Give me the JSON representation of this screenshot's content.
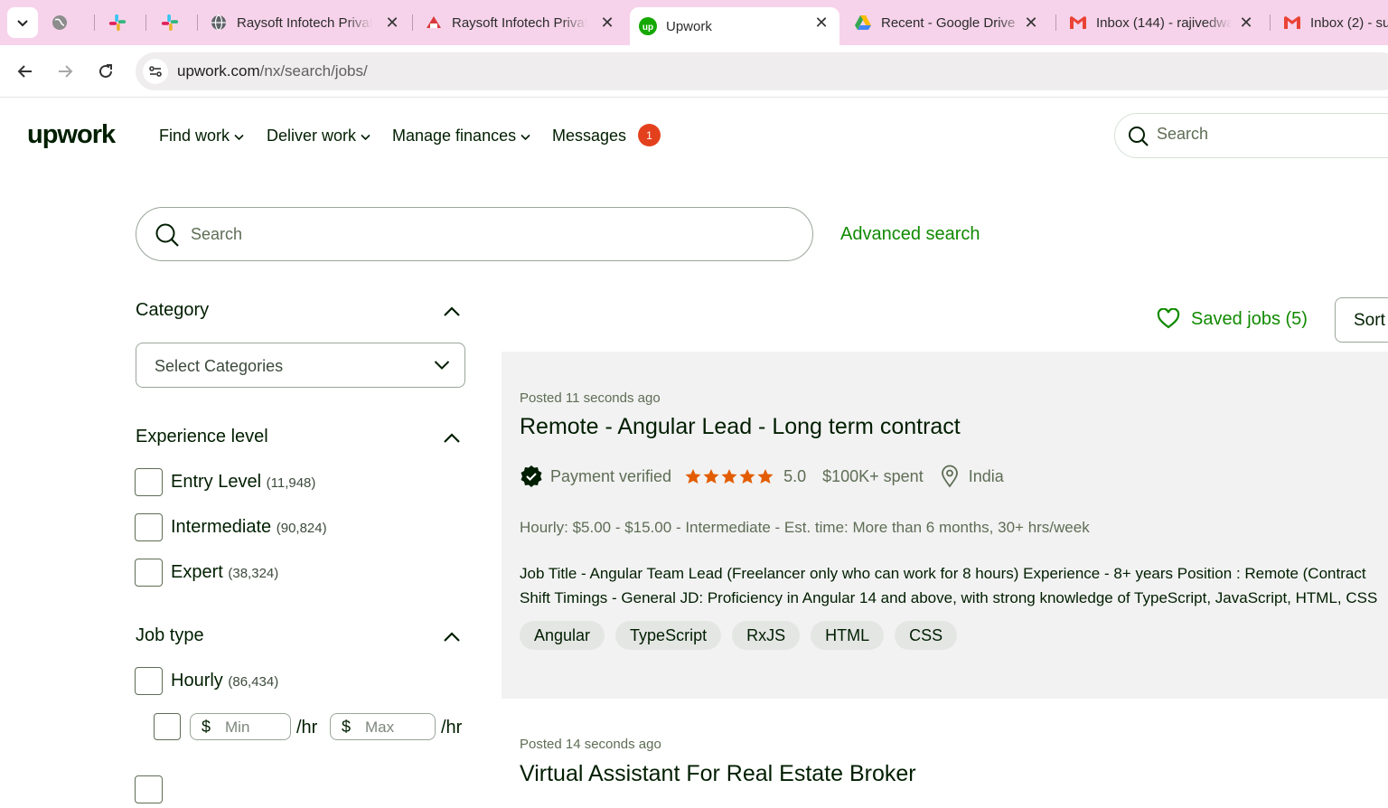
{
  "browser": {
    "tabs": [
      {
        "title": "",
        "icon": "globe-icon"
      },
      {
        "title": "",
        "icon": "slack-icon"
      },
      {
        "title": "",
        "icon": "slack-icon"
      },
      {
        "title": "Raysoft Infotech Privat",
        "icon": "globe-icon"
      },
      {
        "title": "Raysoft Infotech Privat",
        "icon": "raysoft-icon"
      },
      {
        "title": "Upwork",
        "icon": "upwork-icon",
        "active": true
      },
      {
        "title": "Recent - Google Drive",
        "icon": "drive-icon"
      },
      {
        "title": "Inbox (144) - rajivedwa",
        "icon": "gmail-icon"
      },
      {
        "title": "Inbox (2) - su",
        "icon": "gmail-icon"
      }
    ],
    "url_host": "upwork.com",
    "url_path": "/nx/search/jobs/"
  },
  "header": {
    "logo": "upwork",
    "nav": [
      "Find work",
      "Deliver work",
      "Manage finances",
      "Messages"
    ],
    "messages_badge": "1",
    "search_placeholder": "Search"
  },
  "search": {
    "placeholder": "Search",
    "advanced_label": "Advanced search"
  },
  "filters": {
    "category": {
      "title": "Category",
      "select_placeholder": "Select Categories"
    },
    "experience": {
      "title": "Experience level",
      "options": [
        {
          "label": "Entry Level",
          "count": "(11,948)"
        },
        {
          "label": "Intermediate",
          "count": "(90,824)"
        },
        {
          "label": "Expert",
          "count": "(38,324)"
        }
      ]
    },
    "job_type": {
      "title": "Job type",
      "hourly": {
        "label": "Hourly",
        "count": "(86,434)"
      },
      "currency": "$",
      "min_placeholder": "Min",
      "max_placeholder": "Max",
      "per_hr": "/hr"
    }
  },
  "toolbar": {
    "saved_jobs": "Saved jobs (5)",
    "sort_label": "Sort"
  },
  "jobs": [
    {
      "posted": "Posted 11 seconds ago",
      "title": "Remote - Angular Lead - Long term contract",
      "payment": "Payment verified",
      "rating": "5.0",
      "spent": "$100K+ spent",
      "location": "India",
      "terms": "Hourly: $5.00 - $15.00 - Intermediate - Est. time: More than 6 months, 30+ hrs/week",
      "desc_line1": "Job Title - Angular Team Lead (Freelancer only who can work for 8 hours) Experience - 8+ years Position : Remote (Contract",
      "desc_line2": "Shift Timings - General JD: Proficiency in Angular 14 and above, with strong knowledge of TypeScript, JavaScript, HTML, CSS",
      "tags": [
        "Angular",
        "TypeScript",
        "RxJS",
        "HTML",
        "CSS"
      ]
    },
    {
      "posted": "Posted 14 seconds ago",
      "title": "Virtual Assistant For Real Estate Broker"
    }
  ],
  "colors": {
    "brand_green": "#108a00",
    "badge_red": "#e3411d",
    "tab_strip": "#f6d3ea",
    "star": "#e35d00"
  }
}
